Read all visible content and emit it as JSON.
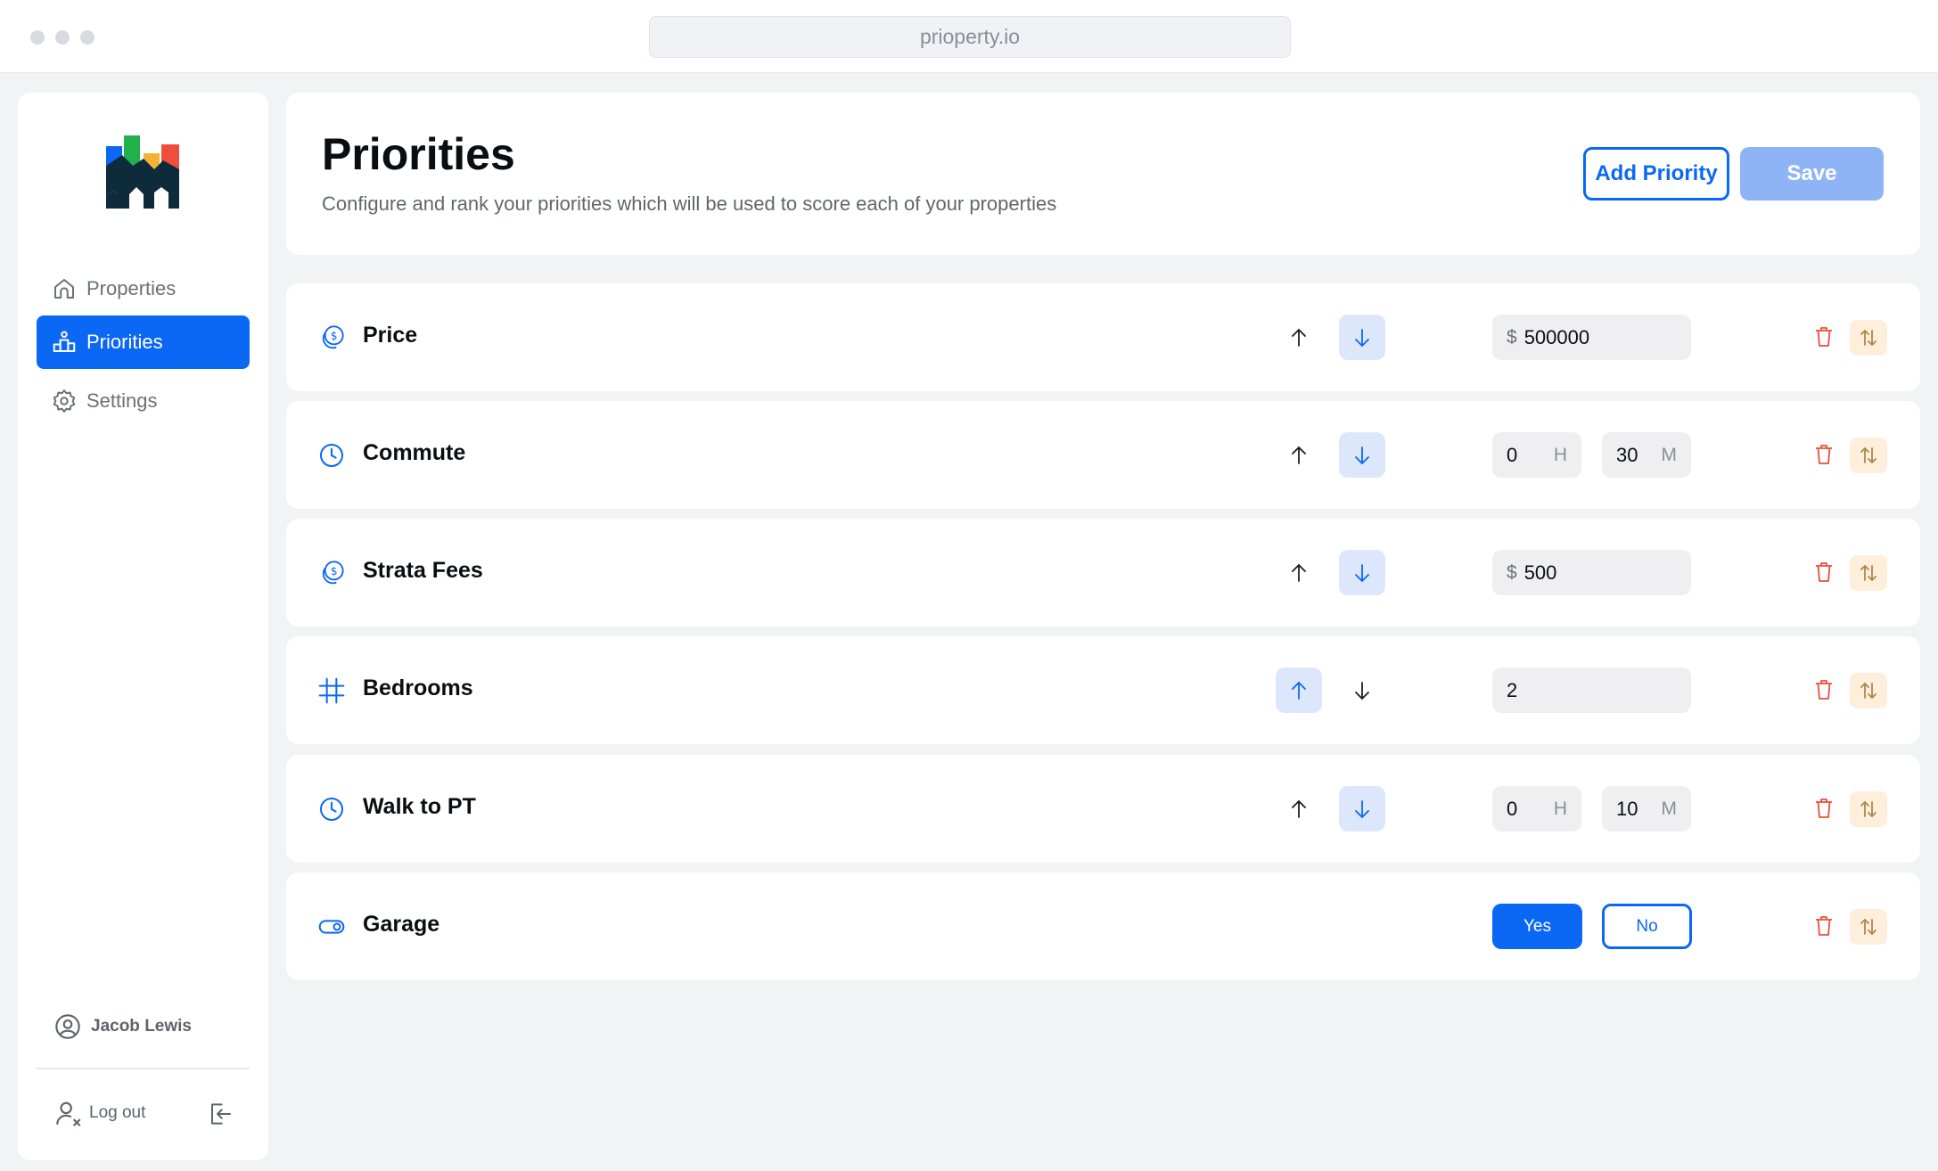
{
  "browser": {
    "url": "prioperty.io"
  },
  "sidebar": {
    "items": [
      {
        "label": "Properties",
        "icon": "home-icon"
      },
      {
        "label": "Priorities",
        "icon": "priorities-icon",
        "active": true
      },
      {
        "label": "Settings",
        "icon": "gear-icon"
      }
    ],
    "user_name": "Jacob Lewis",
    "logout_label": "Log out"
  },
  "header": {
    "title": "Priorities",
    "subtitle": "Configure and rank your priorities which will be used to score each of your properties",
    "add_label": "Add Priority",
    "save_label": "Save"
  },
  "priorities": [
    {
      "name": "Price",
      "icon": "money-icon",
      "kind": "money",
      "currency": "$",
      "value": "500000",
      "direction": "down"
    },
    {
      "name": "Commute",
      "icon": "clock-icon",
      "kind": "time",
      "hours": "0",
      "hours_unit": "H",
      "minutes": "30",
      "minutes_unit": "M",
      "direction": "down"
    },
    {
      "name": "Strata Fees",
      "icon": "money-icon",
      "kind": "money",
      "currency": "$",
      "value": "500",
      "direction": "down"
    },
    {
      "name": "Bedrooms",
      "icon": "hash-icon",
      "kind": "number",
      "value": "2",
      "direction": "up"
    },
    {
      "name": "Walk to PT",
      "icon": "clock-icon",
      "kind": "time",
      "hours": "0",
      "hours_unit": "H",
      "minutes": "10",
      "minutes_unit": "M",
      "direction": "down"
    },
    {
      "name": "Garage",
      "icon": "toggle-icon",
      "kind": "boolean",
      "yes_label": "Yes",
      "no_label": "No",
      "selected": "Yes"
    }
  ],
  "colors": {
    "accent": "#0a68f5",
    "accent_soft": "#dde7fb",
    "save_disabled": "#8fb4f5",
    "delete": "#e8503a",
    "sort_bg": "#fdefdc",
    "sort_icon": "#b0854a"
  }
}
